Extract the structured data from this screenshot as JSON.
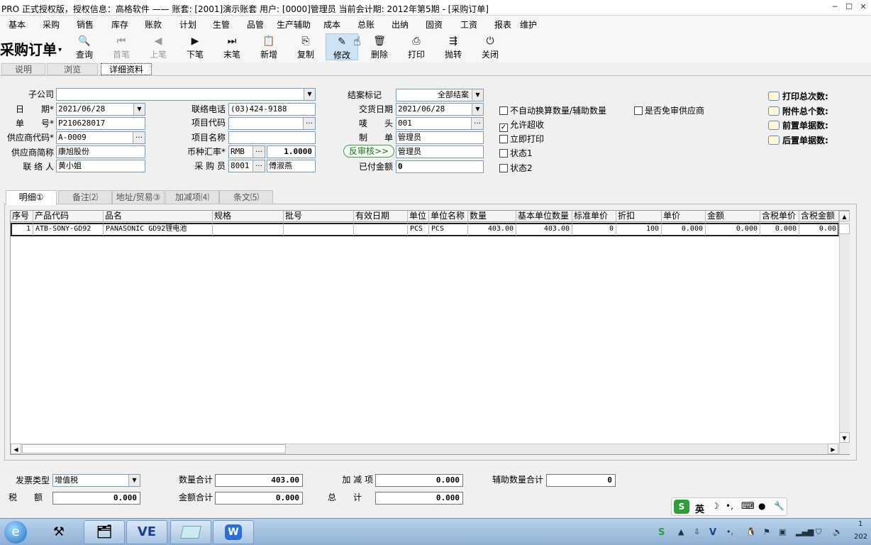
{
  "window": {
    "title": "PRO 正式授权版，授权信息：高格软件 —— 账套: [2001]演示账套  用户: [0000]管理员   当前会计期: 2012年第5期    - [采购订单]",
    "btn_min": "─",
    "btn_max": "☐",
    "btn_close": "✕"
  },
  "menu": [
    "基本",
    "采购",
    "销售",
    "库存",
    "账款",
    "计划",
    "生管",
    "品管",
    "生产辅助",
    "成本",
    "总账",
    "出纳",
    "固资",
    "工资",
    "报表",
    "维护"
  ],
  "form_title": "采购订单",
  "toolbar": {
    "query": "查询",
    "first": "首笔",
    "prev": "上笔",
    "next": "下笔",
    "last": "末笔",
    "new": "新增",
    "copy": "复制",
    "edit": "修改",
    "delete": "删除",
    "print": "打印",
    "toss": "抛转",
    "close": "关闭"
  },
  "tabs": [
    "说明",
    "浏览",
    "详细资料"
  ],
  "header": {
    "subsidiary_label": "子公司",
    "subsidiary": "",
    "date_label": "日　　期*",
    "date": "2021/06/28",
    "order_no_label": "单　　号*",
    "order_no": "P210628017",
    "vendor_code_label": "供应商代码*",
    "vendor_code": "A-0009",
    "vendor_name_label": "供应商简称",
    "vendor_name": "康旭股份",
    "contact_label": "联 络 人",
    "contact": "黄小姐",
    "phone_label": "联络电话",
    "phone": "(03)424-9188",
    "project_code_label": "项目代码",
    "project_code": "",
    "project_name_label": "项目名称",
    "project_name": "",
    "currency_label": "币种汇率*",
    "currency": "RMB",
    "rate": "1.0000",
    "buyer_label": "采 购 员",
    "buyer_code": "8001",
    "buyer_name": "傅淑燕",
    "close_flag_label": "结案标记",
    "close_flag": "全部结案",
    "delivery_label": "交货日期",
    "delivery": "2021/06/28",
    "mark_label": "唛　　头",
    "mark": "001",
    "maker_label": "制　　单",
    "maker": "管理员",
    "unaudit_btn": "反审核>>",
    "auditor": "管理员",
    "paid_label": "已付金额",
    "paid": "0"
  },
  "checks": [
    {
      "label": "不自动换算数量/辅助数量",
      "checked": ""
    },
    {
      "label": "允许超收",
      "checked": "✓"
    },
    {
      "label": "立即打印",
      "checked": ""
    },
    {
      "label": "状态1",
      "checked": ""
    },
    {
      "label": "状态2",
      "checked": ""
    }
  ],
  "free_audit": {
    "label": "是否免审供应商",
    "checked": ""
  },
  "stats": [
    "打印总次数:",
    "附件总个数:",
    "前置单据数:",
    "后置单据数:"
  ],
  "detail_tabs": [
    "明细①",
    "备注⑵",
    "地址/贸易③",
    "加减项⑷",
    "条文⑸"
  ],
  "grid": {
    "columns": [
      "序号",
      "产品代码",
      "品名",
      "规格",
      "批号",
      "有效日期",
      "单位",
      "单位名称",
      "数量",
      "基本单位数量",
      "标准单价",
      "折扣",
      "单价",
      "金额",
      "含税单价",
      "含税金额"
    ],
    "rows": [
      [
        "1",
        "ATB-SONY-GD92",
        "PANASONIC GD92锂电池",
        "",
        "",
        "",
        "PCS",
        "PCS",
        "403.00",
        "403.00",
        "0",
        "100",
        "0.000",
        "0.000",
        "0.000",
        "0.00"
      ]
    ]
  },
  "footer": {
    "invoice_type_label": "发票类型",
    "invoice_type": "增值税",
    "tax_label": "税　　额",
    "tax": "0.000",
    "qty_total_label": "数量合计",
    "qty_total": "403.00",
    "amount_total_label": "金额合计",
    "amount_total": "0.000",
    "adjust_label": "加 减 项",
    "adjust": "0.000",
    "grand_label": "总　　计",
    "grand": "0.000",
    "aux_qty_label": "辅助数量合计",
    "aux_qty": "0"
  },
  "ime": {
    "logo": "S",
    "lang": "英"
  },
  "taskbar": {
    "apps": [
      "🗂",
      "VE",
      "",
      "W"
    ],
    "clock": [
      "1",
      "202"
    ]
  }
}
